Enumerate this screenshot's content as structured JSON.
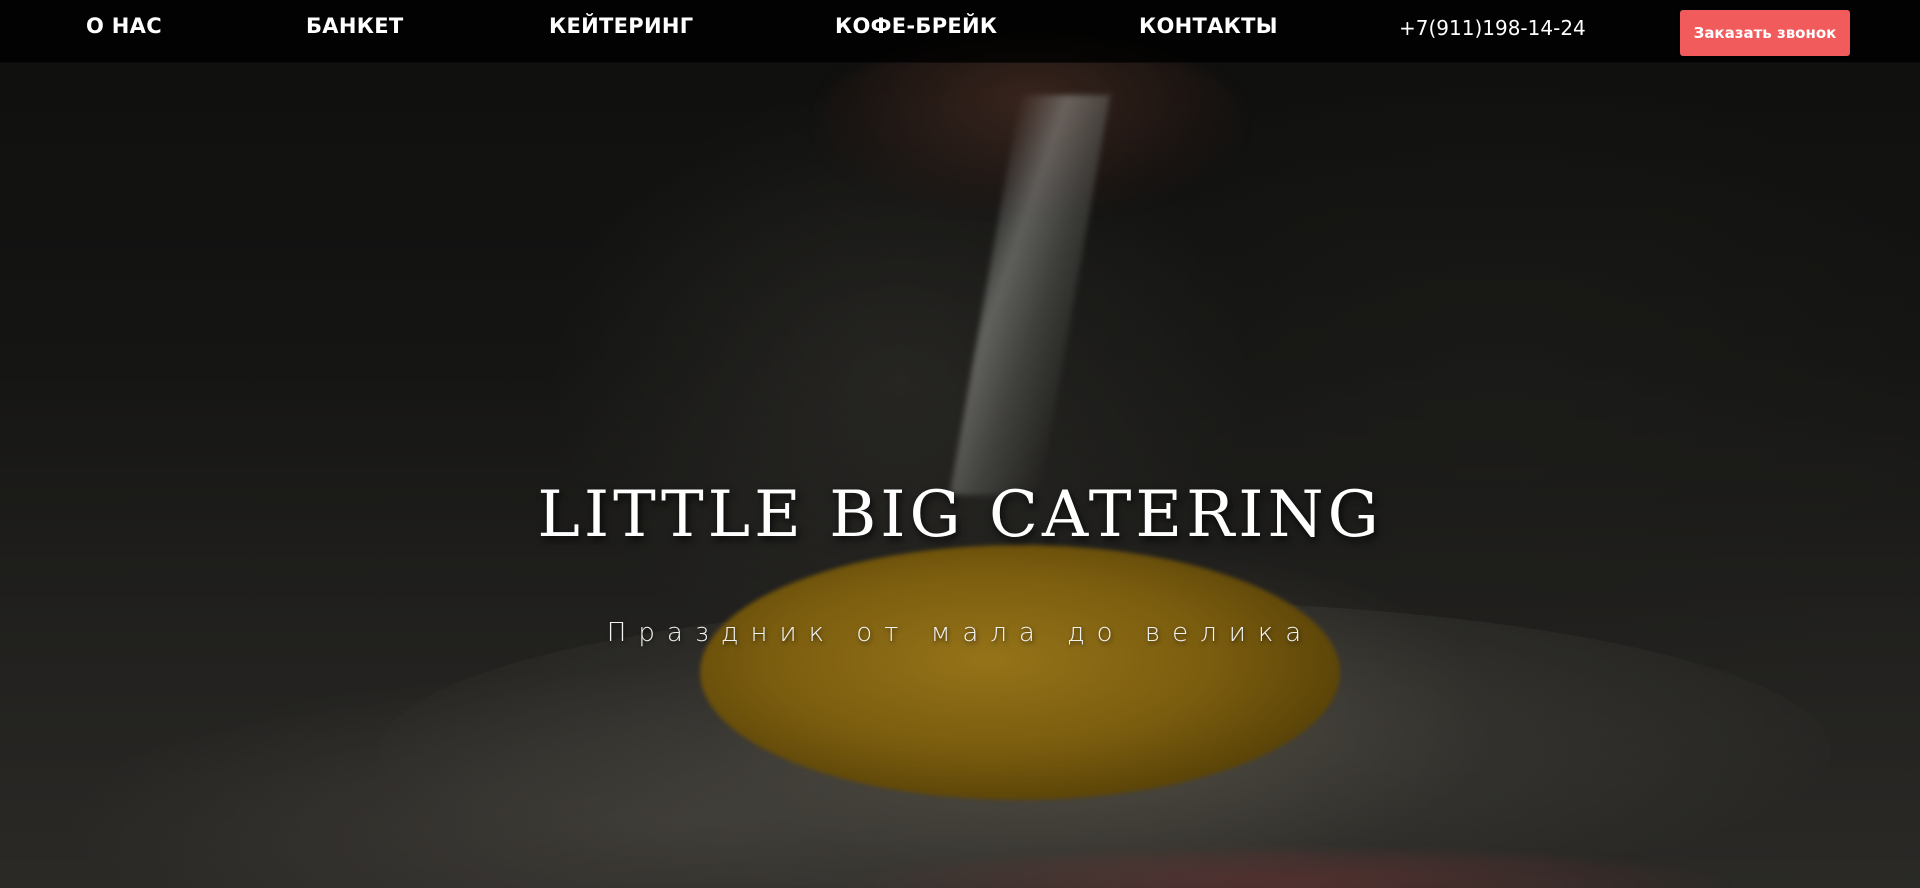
{
  "nav": {
    "items": [
      {
        "label": "О НАС"
      },
      {
        "label": "БАНКЕТ"
      },
      {
        "label": "КЕЙТЕРИНГ"
      },
      {
        "label": "КОФЕ-БРЕЙК"
      },
      {
        "label": "КОНТАКТЫ"
      }
    ],
    "phone": "+7(911)198-14-24",
    "call_button_label": "Заказать звонок"
  },
  "hero": {
    "title": "LITTLE BIG CATERING",
    "subtitle": "Праздник от мала до велика"
  },
  "colors": {
    "call_button": "#f25b5b",
    "nav_text": "#ffffff",
    "header_background": "#000000"
  }
}
